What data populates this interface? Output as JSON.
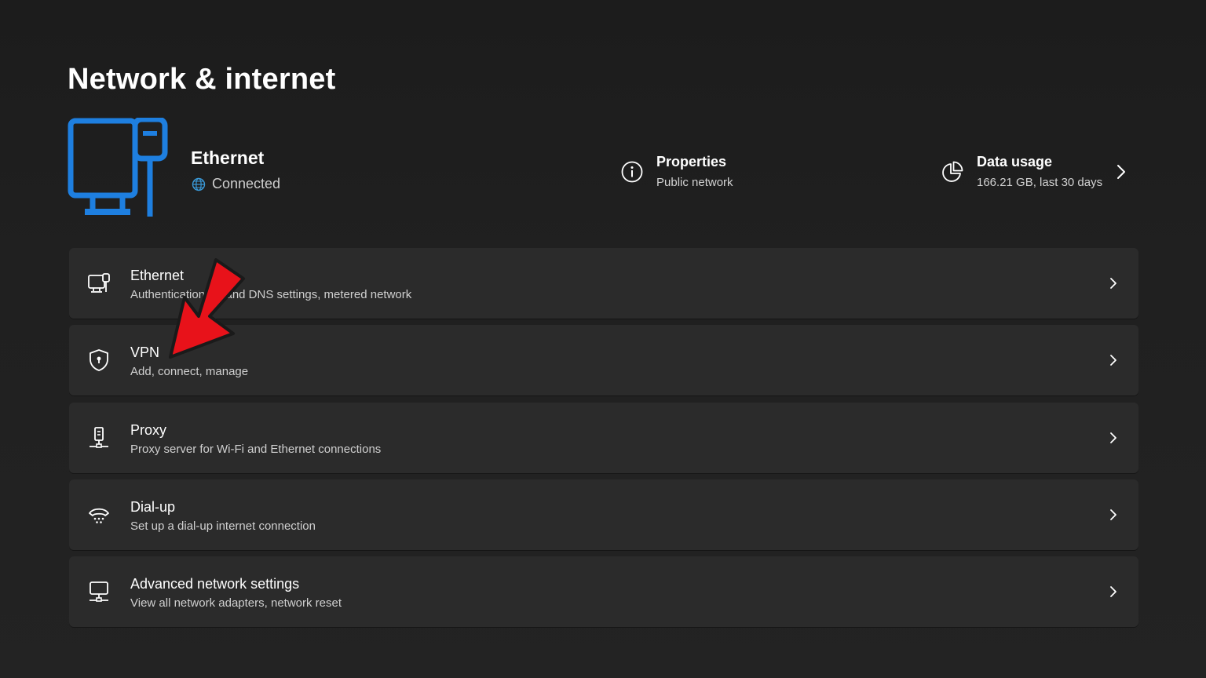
{
  "page": {
    "title": "Network & internet"
  },
  "hero": {
    "connection_name": "Ethernet",
    "status": "Connected",
    "properties": {
      "title": "Properties",
      "subtitle": "Public network"
    },
    "data_usage": {
      "title": "Data usage",
      "subtitle": "166.21 GB, last 30 days"
    }
  },
  "items": [
    {
      "title": "Ethernet",
      "subtitle": "Authentication, IP and DNS settings, metered network",
      "icon": "ethernet-icon"
    },
    {
      "title": "VPN",
      "subtitle": "Add, connect, manage",
      "icon": "shield-icon"
    },
    {
      "title": "Proxy",
      "subtitle": "Proxy server for Wi-Fi and Ethernet connections",
      "icon": "proxy-server-icon"
    },
    {
      "title": "Dial-up",
      "subtitle": "Set up a dial-up internet connection",
      "icon": "dial-up-icon"
    },
    {
      "title": "Advanced network settings",
      "subtitle": "View all network adapters, network reset",
      "icon": "advanced-network-icon"
    }
  ],
  "colors": {
    "accent": "#1e7fe0",
    "background": "#202020",
    "card": "#2b2b2b",
    "annotation_arrow": "#e8121a"
  }
}
